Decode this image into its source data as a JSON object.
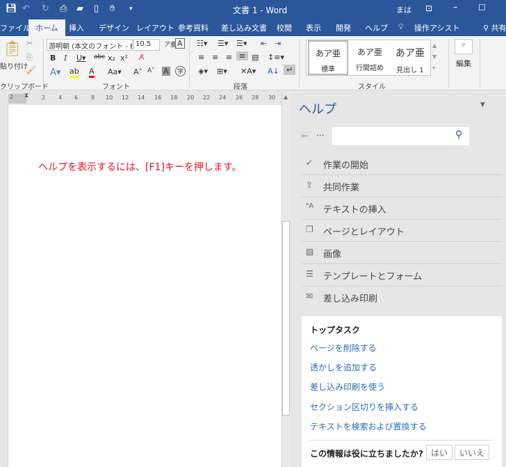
{
  "titlebar": {
    "title": "文書 1  -  Word",
    "user_partial": "まは",
    "quick_access": [
      "save-icon",
      "undo-icon",
      "redo-icon",
      "print-preview-icon",
      "open-icon",
      "new-icon",
      "touch-mode-icon",
      "customize-icon"
    ]
  },
  "tabs": [
    "ファイル",
    "ホーム",
    "挿入",
    "デザイン",
    "レイアウト",
    "参考資料",
    "差し込み文書",
    "校閲",
    "表示",
    "開発",
    "ヘルプ",
    "操作アシスト",
    "共有"
  ],
  "ribbon": {
    "clipboard": {
      "paste": "貼り付け",
      "label": "クリップボード"
    },
    "font": {
      "name": "游明朝 (本文のフォント - E",
      "size": "10.5",
      "label": "フォント",
      "highlight_color": "#ffff00",
      "font_color": "#ff0000"
    },
    "paragraph": {
      "label": "段落"
    },
    "styles": {
      "label": "スタイル",
      "items": [
        {
          "sample": "あア亜",
          "name": "標準"
        },
        {
          "sample": "あア亜",
          "name": "行間詰め"
        },
        {
          "sample": "あア亜",
          "name": "見出し 1"
        }
      ]
    },
    "editing": {
      "label": "編集"
    }
  },
  "ruler": {
    "ticks": [
      "2",
      "2",
      "4",
      "6",
      "8",
      "10",
      "12",
      "14",
      "16",
      "18",
      "20",
      "22",
      "24",
      "26",
      "28",
      "30"
    ]
  },
  "document": {
    "text": "ヘルプを表示するには、[F1]キーを押します。",
    "text_color": "#e81123"
  },
  "help": {
    "title": "ヘルプ",
    "search_placeholder": "",
    "items": [
      {
        "icon": "check-icon",
        "glyph": "✓",
        "label": "作業の開始"
      },
      {
        "icon": "share-icon",
        "glyph": "⇪",
        "label": "共同作業"
      },
      {
        "icon": "text-size-icon",
        "glyph": "ᴬA",
        "label": "テキストの挿入"
      },
      {
        "icon": "pages-icon",
        "glyph": "❐",
        "label": "ページとレイアウト"
      },
      {
        "icon": "image-icon",
        "glyph": "▨",
        "label": "画像"
      },
      {
        "icon": "list-icon",
        "glyph": "☰",
        "label": "テンプレートとフォーム"
      },
      {
        "icon": "mail-icon",
        "glyph": "✉",
        "label": "差し込み印刷"
      }
    ],
    "top_tasks": {
      "title": "トップタスク",
      "links": [
        "ページを削除する",
        "透かしを追加する",
        "差し込み印刷を使う",
        "セクション区切りを挿入する",
        "テキストを検索および置換する"
      ]
    },
    "feedback": {
      "question": "この情報は役に立ちましたか?",
      "yes": "はい",
      "no": "いいえ"
    }
  }
}
